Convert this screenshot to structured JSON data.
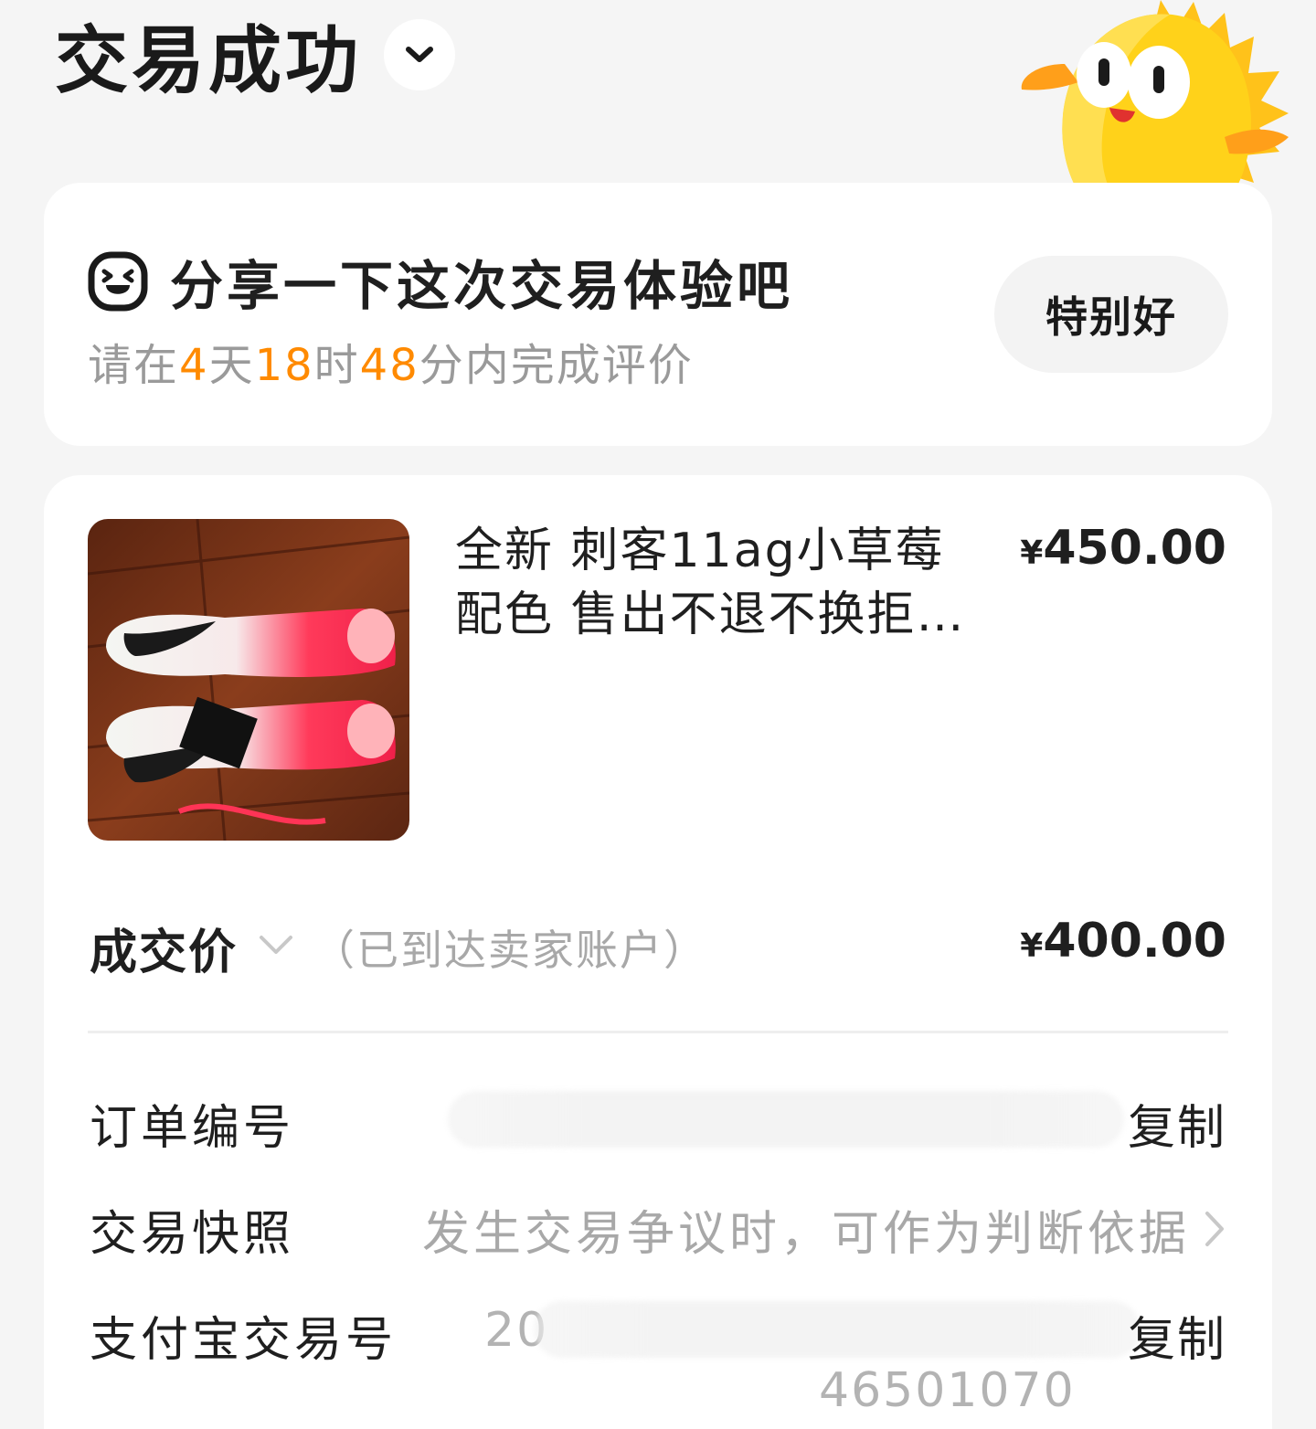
{
  "header": {
    "title": "交易成功"
  },
  "review": {
    "title": "分享一下这次交易体验吧",
    "sub_prefix": "请在",
    "days": "4",
    "days_unit": "天",
    "hours": "18",
    "hours_unit": "时",
    "minutes": "48",
    "sub_suffix": "分内完成评价",
    "button_label": "特别好"
  },
  "product": {
    "title": "全新 刺客11ag小草莓配色 售出不退不换拒…",
    "price_symbol": "¥",
    "price": "450.00"
  },
  "deal": {
    "label": "成交价",
    "note": "（已到达卖家账户）",
    "price_symbol": "¥",
    "price": "400.00"
  },
  "order": {
    "order_no_label": "订单编号",
    "copy_label": "复制",
    "snapshot_label": "交易快照",
    "snapshot_hint": "发生交易争议时，可作为判断依据",
    "alipay_label": "支付宝交易号",
    "alipay_partial": "20",
    "alipay_tail": "46501070",
    "alipay_copy_label": "复制"
  },
  "colors": {
    "accent": "#ff8a00",
    "card": "#ffffff",
    "background": "#f5f5f5",
    "muted": "#9a9a9a"
  }
}
